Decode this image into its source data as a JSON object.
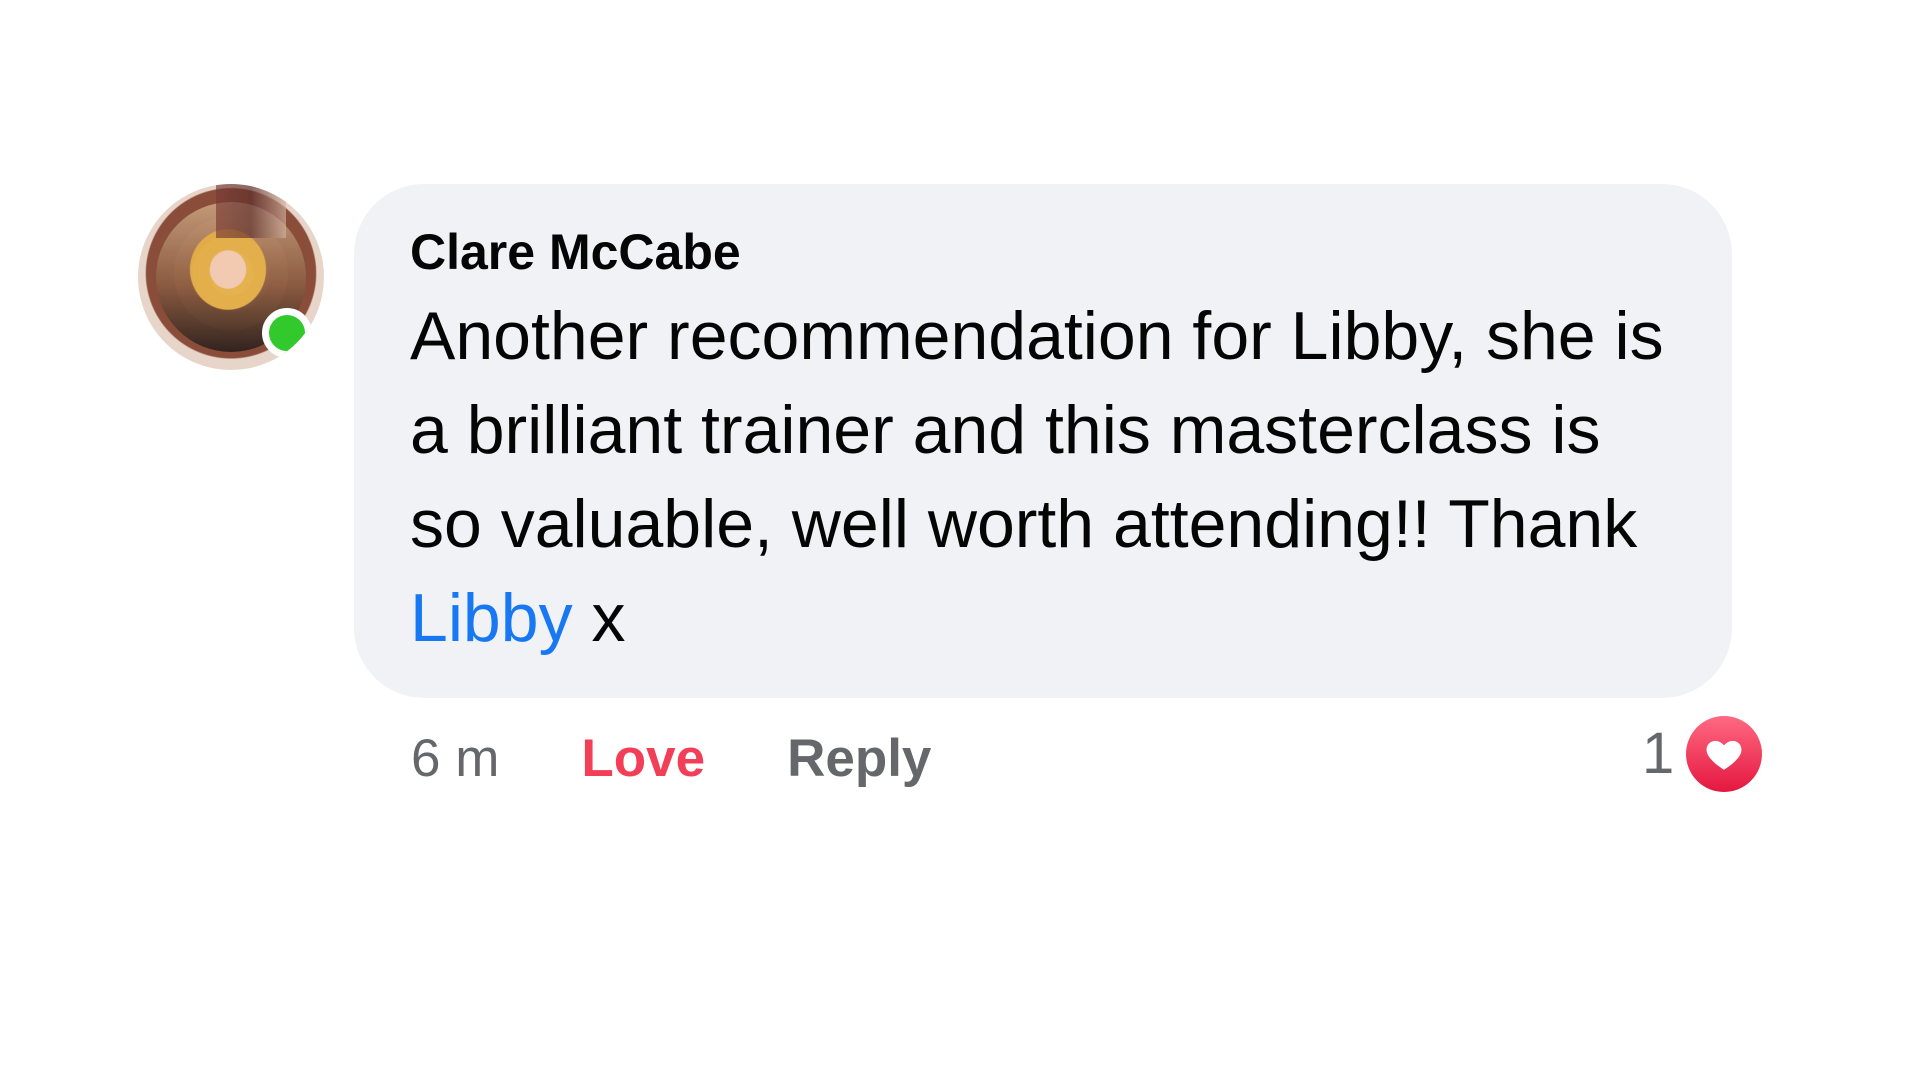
{
  "comment": {
    "author": "Clare McCabe",
    "text_before": "Another recommendation for Libby, she is a brilliant trainer and this masterclass is so valuable, well worth attending!! Thank ",
    "mention": "Libby",
    "text_after": " x",
    "timestamp": "6 m",
    "reaction_label": "Love",
    "reply_label": "Reply",
    "reaction_count": "1",
    "online_status": "online",
    "icons": {
      "avatar": "profile-avatar",
      "online": "online-status-dot",
      "reaction": "heart-icon"
    },
    "colors": {
      "bubble": "#f0f2f5",
      "mention": "#1877f2",
      "love": "#f33e58",
      "online": "#31c92c",
      "meta": "#65676b"
    }
  }
}
